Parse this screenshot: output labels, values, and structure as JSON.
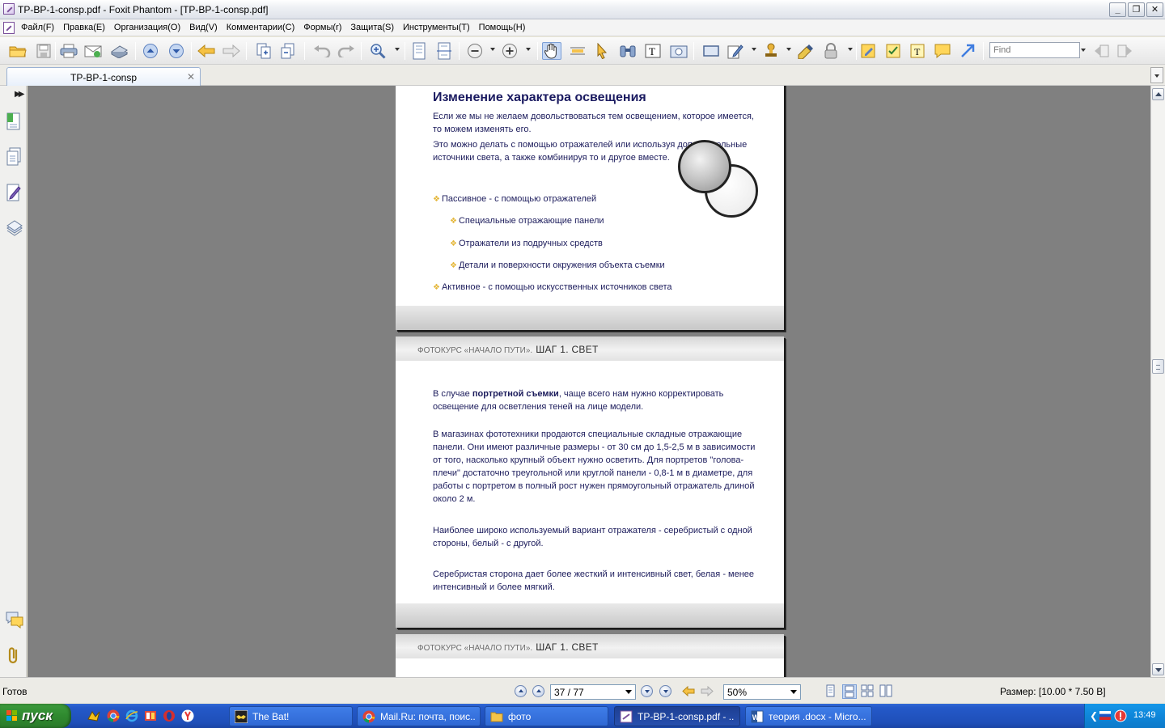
{
  "window": {
    "title": "TP-BP-1-consp.pdf - Foxit Phantom - [TP-BP-1-consp.pdf]"
  },
  "menu": {
    "items": [
      "Файл(F)",
      "Правка(E)",
      "Организация(O)",
      "Вид(V)",
      "Комментарии(C)",
      "Формы(r)",
      "Защита(S)",
      "Инструменты(T)",
      "Помощь(H)"
    ]
  },
  "toolbar": {
    "find_placeholder": "Find"
  },
  "tabs": [
    {
      "label": "TP-BP-1-consp"
    }
  ],
  "page1": {
    "title": "Изменение характера освещения",
    "para1": "Если же мы не желаем довольствоваться тем освещением, которое имеется, то можем изменять его.",
    "para2": "Это можно делать с помощью отражателей или используя дополнительные источники света, а также комбинируя то и другое вместе.",
    "bullets": [
      "Пассивное  - с помощью отражателей",
      "Специальные отражающие панели",
      "Отражатели из подручных средств",
      "Детали и поверхности окружения объекта съемки",
      "Активное - с помощью искусственных  источников света"
    ]
  },
  "page_header": {
    "course": "ФОТОКУРС «НАЧАЛО ПУТИ».",
    "step": "ШАГ 1.  СВЕТ"
  },
  "page2": {
    "para1_pre": "В случае ",
    "para1_bold": "портретной съемки",
    "para1_post": ", чаще всего нам нужно корректировать освещение для осветления теней на лице модели.",
    "para2": "В магазинах фототехники продаются специальные складные отражающие  панели. Они имеют различные размеры - от 30 см до 1,5-2,5 м в зависимости от того, насколько крупный объект нужно осветить. Для портретов \"голова-плечи\" достаточно треугольной или круглой панели - 0,8-1 м в диаметре, для работы с портретом в полный рост нужен прямоугольный  отражатель длиной около 2 м.",
    "para3": "Наиболее широко используемый вариант отражателя - серебристый с одной стороны, белый - с другой.",
    "para4": "Серебристая сторона дает более жесткий и интенсивный свет, белая - менее интенсивный и более мягкий."
  },
  "status": {
    "text": "Готов",
    "page_indicator": "37 / 77",
    "zoom": "50%",
    "size": "Размер: [10.00 * 7.50 В]"
  },
  "taskbar": {
    "start_label": "пуск",
    "tasks": [
      {
        "label": "The Bat!"
      },
      {
        "label": "Mail.Ru: почта, поис..."
      },
      {
        "label": "фото"
      },
      {
        "label": "TP-BP-1-consp.pdf - ..."
      },
      {
        "label": "теория .docx - Micro..."
      }
    ],
    "clock": "13:49"
  },
  "colors": {
    "accent": "#1a1a60",
    "bullet": "#e4b73a",
    "taskbar": "#245edb",
    "start": "#2f8a2f"
  }
}
